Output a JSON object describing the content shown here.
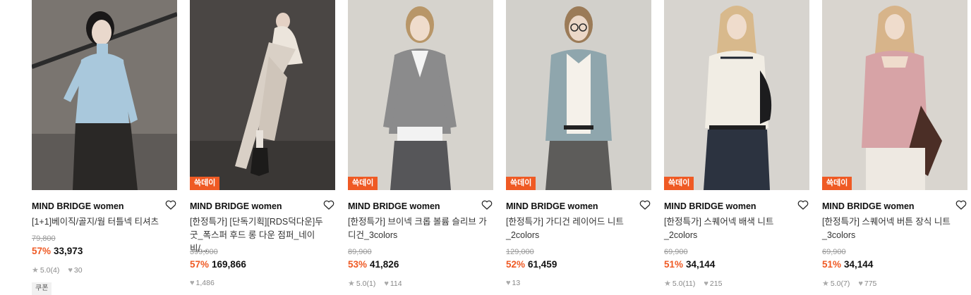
{
  "products": [
    {
      "badge": "",
      "brand": "MIND BRIDGE women",
      "title": "[1+1]베이직/골지/웜 터틀넥 티셔츠",
      "original_price": "79,800",
      "discount": "57%",
      "price": "33,973",
      "rating": "5.0",
      "review_count": "(4)",
      "likes": "30",
      "coupon": "쿠폰",
      "image_alt": "model in light blue turtleneck and dark pleated trousers"
    },
    {
      "badge": "쓱데이",
      "brand": "MIND BRIDGE women",
      "title": "[한정특가] [단독기획][RDS덕다운]두굿_폭스퍼 후드 롱 다운 점퍼_네이비/...",
      "original_price": "399,000",
      "discount": "57%",
      "price": "169,866",
      "rating": "",
      "review_count": "",
      "likes": "1,486",
      "coupon": "",
      "image_alt": "model in long ivory down coat with fur hood"
    },
    {
      "badge": "쓱데이",
      "brand": "MIND BRIDGE women",
      "title": "[한정특가] 브이넥 크롭 볼륨 슬리브 가디건_3colors",
      "original_price": "89,900",
      "discount": "53%",
      "price": "41,826",
      "rating": "5.0",
      "review_count": "(1)",
      "likes": "114",
      "coupon": "",
      "image_alt": "model in grey cropped v-neck cardigan"
    },
    {
      "badge": "쓱데이",
      "brand": "MIND BRIDGE women",
      "title": "[한정특가] 가디건 레이어드 니트_2colors",
      "original_price": "129,000",
      "discount": "52%",
      "price": "61,459",
      "rating": "",
      "review_count": "",
      "likes": "13",
      "coupon": "",
      "image_alt": "model with glasses in blue-grey layered cardigan"
    },
    {
      "badge": "쓱데이",
      "brand": "MIND BRIDGE women",
      "title": "[한정특가] 스퀘어넥 배색 니트_2colors",
      "original_price": "69,900",
      "discount": "51%",
      "price": "34,144",
      "rating": "5.0",
      "review_count": "(11)",
      "likes": "215",
      "coupon": "",
      "image_alt": "model in ivory square-neck knit with navy skirt"
    },
    {
      "badge": "쓱데이",
      "brand": "MIND BRIDGE women",
      "title": "[한정특가] 스퀘어넥 버튼 장식 니트_3colors",
      "original_price": "69,900",
      "discount": "51%",
      "price": "34,144",
      "rating": "5.0",
      "review_count": "(7)",
      "likes": "775",
      "coupon": "",
      "image_alt": "model in pink square-neck button knit"
    }
  ],
  "icons": {
    "star": "star-icon",
    "heart": "heart-icon",
    "wishlist": "wishlist-heart-icon"
  },
  "colors": {
    "accent": "#ef5a24",
    "text": "#111111",
    "muted": "#999999"
  }
}
